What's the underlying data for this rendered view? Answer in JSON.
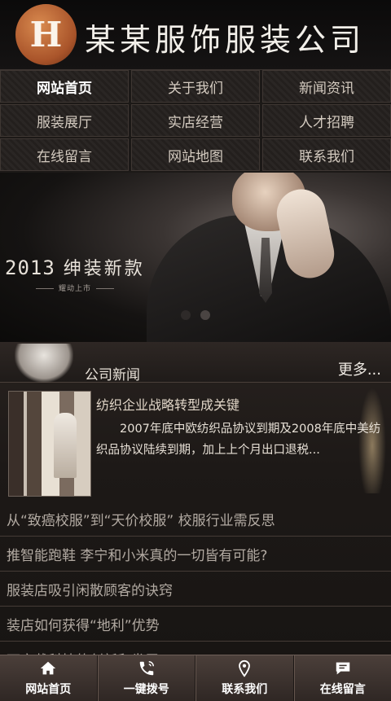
{
  "header": {
    "logo_text": "H",
    "site_title": "某某服饰服装公司"
  },
  "nav": {
    "items": [
      {
        "label": "网站首页",
        "active": true
      },
      {
        "label": "关于我们"
      },
      {
        "label": "新闻资讯"
      },
      {
        "label": "服装展厅"
      },
      {
        "label": "实店经营"
      },
      {
        "label": "人才招聘"
      },
      {
        "label": "在线留言"
      },
      {
        "label": "网站地图"
      },
      {
        "label": "联系我们"
      }
    ]
  },
  "banner": {
    "year": "2013",
    "headline": "绅装新款",
    "subline": "耀动上市"
  },
  "news": {
    "title": "公司新闻",
    "more": "更多...",
    "feature": {
      "title": "纺织企业战略转型成关键",
      "desc": "2007年底中欧纺织品协议到期及2008年底中美纺织品协议陆续到期，加上上个月出口退税..."
    },
    "items": [
      "从“致癌校服”到“天价校服” 校服行业需反思",
      "推智能跑鞋 李宁和小米真的一切皆有可能?",
      "服装店吸引闲散顾客的诀窍",
      "装店如何获得“地利”优势",
      "可穿戴科技的创新和发展"
    ]
  },
  "footer": {
    "buttons": [
      {
        "label": "网站首页",
        "icon": "home-icon"
      },
      {
        "label": "一键拨号",
        "icon": "phone-icon"
      },
      {
        "label": "联系我们",
        "icon": "location-pin-icon"
      },
      {
        "label": "在线留言",
        "icon": "message-icon"
      }
    ]
  },
  "colors": {
    "background": "#1c1917",
    "nav_cell": "#2a2624",
    "footer": "#4b3f3a",
    "logo": "#a9542a"
  }
}
